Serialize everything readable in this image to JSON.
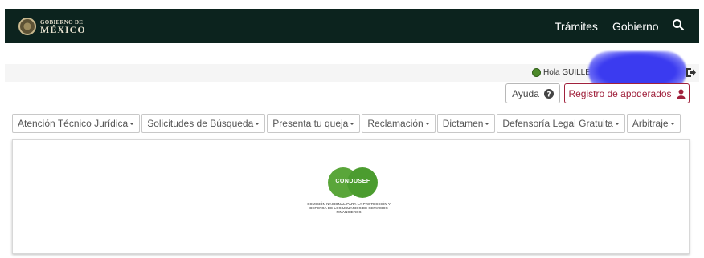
{
  "header": {
    "logo_small": "GOBIERNO DE",
    "logo_big": "MÉXICO",
    "nav": [
      "Trámites",
      "Gobierno"
    ],
    "search_icon": "search-icon"
  },
  "userbar": {
    "greeting": "Hola GUILLERM",
    "logout_icon": "logout-icon"
  },
  "actions": {
    "ayuda_label": "Ayuda",
    "ayuda_icon": "question-circle-icon",
    "registro_label": "Registro de apoderados",
    "registro_icon": "user-icon",
    "registro_color": "#a0213c"
  },
  "menu": [
    "Atención Técnico Jurídica",
    "Solicitudes de Búsqueda",
    "Presenta tu queja",
    "Reclamación",
    "Dictamen",
    "Defensoría Legal Gratuita",
    "Arbitraje"
  ],
  "brand": {
    "name": "CONDUSEF",
    "subtitle": "COMISIÓN NACIONAL PARA LA PROTECCIÓN Y DEFENSA DE LOS USUARIOS DE SERVICIOS FINANCIEROS",
    "color": "#5aa63a"
  },
  "colors": {
    "topbar": "#0c231e"
  }
}
